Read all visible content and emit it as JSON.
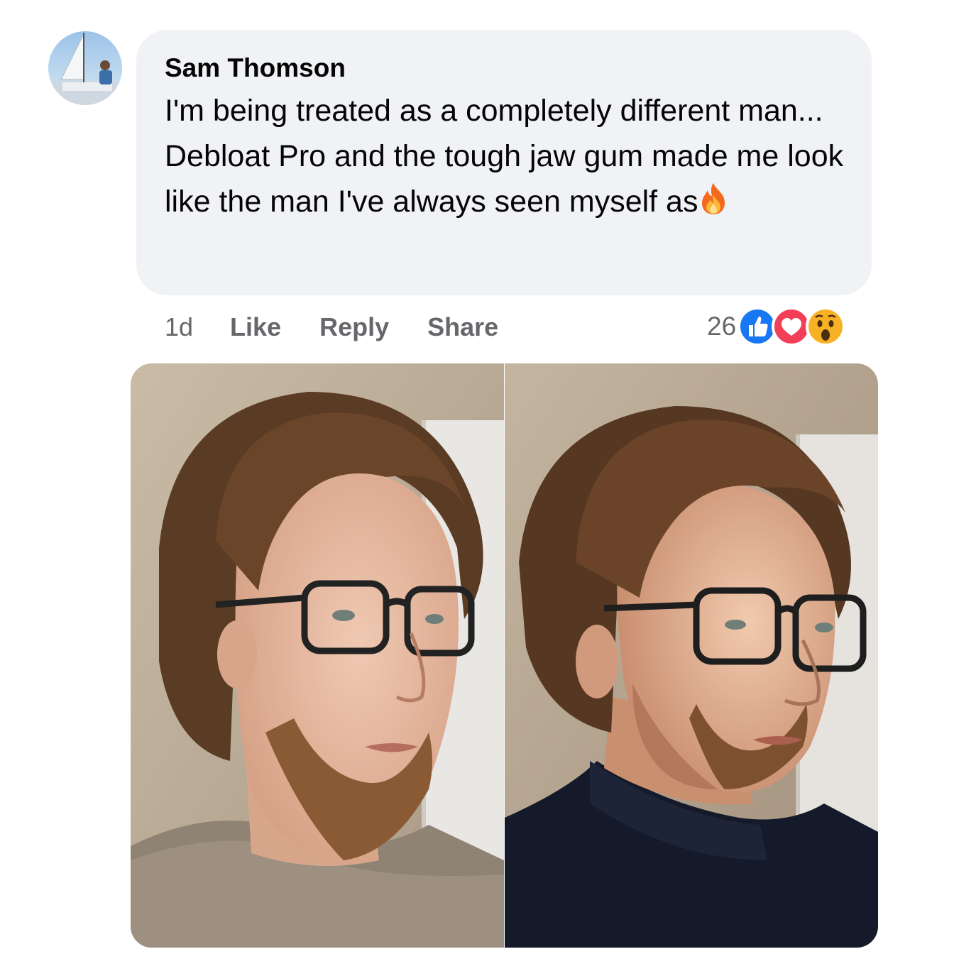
{
  "comment": {
    "author": "Sam Thomson",
    "text": "I'm being treated as a completely different man... Debloat Pro and the tough jaw gum made me look like the man I've always seen myself as",
    "emoji": "fire-icon"
  },
  "actions": {
    "time": "1d",
    "like": "Like",
    "reply": "Reply",
    "share": "Share"
  },
  "reactions": {
    "count": "26",
    "types": [
      "like-icon",
      "love-icon",
      "wow-icon"
    ],
    "colors": {
      "like": "#1877f2",
      "love": "#f33e58",
      "wow": "#f7b125"
    }
  },
  "photos": [
    {
      "name": "before-photo"
    },
    {
      "name": "after-photo"
    }
  ]
}
